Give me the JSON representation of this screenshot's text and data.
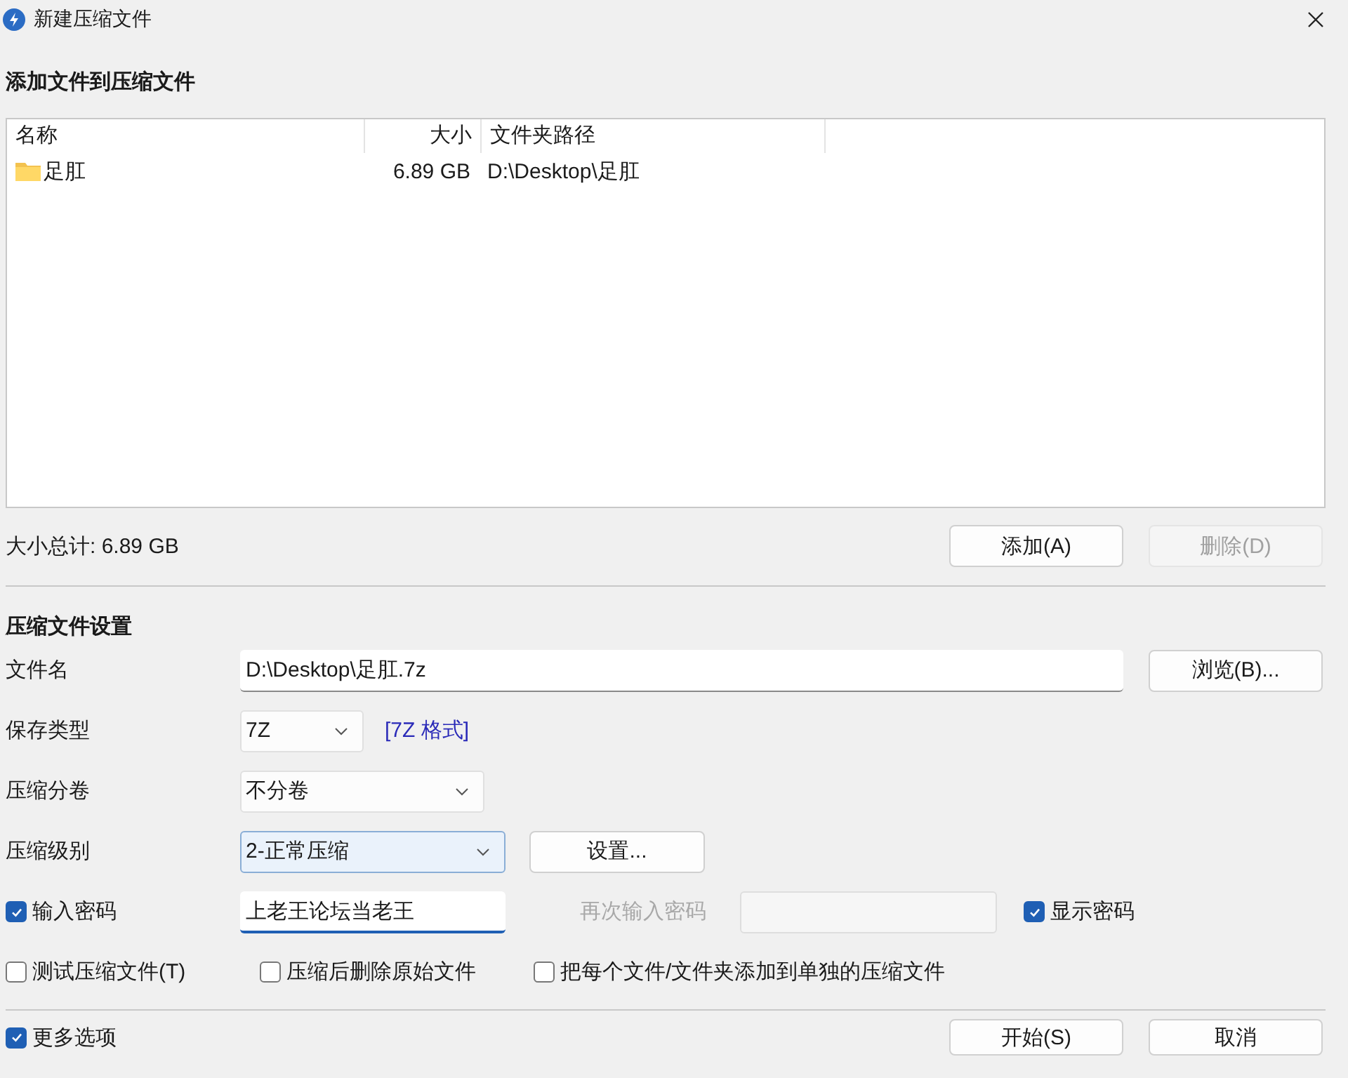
{
  "window": {
    "title": "新建压缩文件"
  },
  "files": {
    "heading": "添加文件到压缩文件",
    "columns": [
      "名称",
      "大小",
      "文件夹路径"
    ],
    "rows": [
      {
        "name": "足肛",
        "size": "6.89 GB",
        "path": "D:\\Desktop\\足肛"
      }
    ],
    "total": "大小总计: 6.89 GB",
    "buttons": [
      {
        "label": "添加(A)",
        "disabled": false
      },
      {
        "label": "删除(D)",
        "disabled": true
      }
    ]
  },
  "settings": {
    "heading": "压缩文件设置",
    "filename": {
      "label": "文件名",
      "value": "D:\\Desktop\\足肛.7z",
      "button": "浏览(B)..."
    },
    "format": {
      "label": "保存类型",
      "value": "7Z",
      "link": "[7Z 格式]"
    },
    "volume": {
      "label": "压缩分卷",
      "value": "不分卷"
    },
    "level": {
      "label": "压缩级别",
      "value": "2-正常压缩",
      "button": "设置..."
    },
    "password": {
      "label": "输入密码",
      "checked": true,
      "value": "上老王论坛当老王"
    },
    "confirm": {
      "label": "再次输入密码",
      "disabled": true
    },
    "show_password": {
      "label": "显示密码",
      "checked": true
    },
    "options": [
      {
        "label": "测试压缩文件(T)",
        "checked": false
      },
      {
        "label": "压缩后删除原始文件",
        "checked": false
      },
      {
        "label": "把每个文件/文件夹添加到单独的压缩文件",
        "checked": false
      }
    ]
  },
  "more_options": {
    "label": "更多选项",
    "checked": true
  },
  "actions": [
    {
      "label": "开始(S)"
    },
    {
      "label": "取消"
    }
  ]
}
